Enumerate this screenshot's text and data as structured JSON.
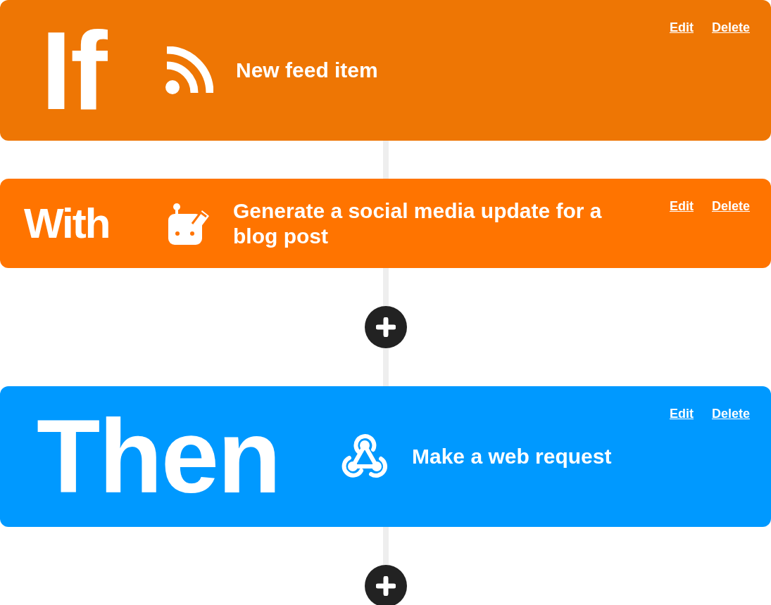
{
  "flow": [
    {
      "kind": "trigger",
      "keyword": "If",
      "title": "New feed item",
      "color": "#ee7604",
      "links": [
        "Edit",
        "Delete"
      ]
    },
    {
      "kind": "query",
      "keyword": "With",
      "title": "Generate a social media update for a blog post",
      "color": "#ff7400",
      "links": [
        "Edit",
        "Delete"
      ]
    },
    {
      "kind": "add"
    },
    {
      "kind": "action",
      "keyword": "Then",
      "title": "Make a web request",
      "color": "#0099ff",
      "links": [
        "Edit",
        "Delete"
      ]
    },
    {
      "kind": "add"
    }
  ]
}
